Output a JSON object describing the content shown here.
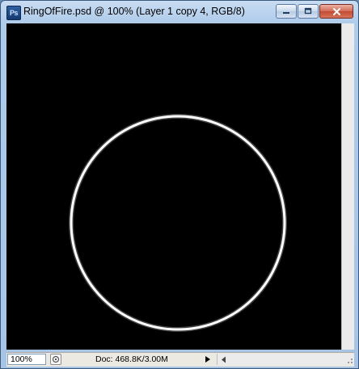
{
  "window": {
    "title": "RingOfFire.psd @ 100% (Layer 1 copy 4, RGB/8)",
    "app_icon_text": "Ps",
    "buttons": {
      "minimize_icon": "minimize-icon",
      "maximize_icon": "maximize-icon",
      "close_icon": "close-icon"
    }
  },
  "canvas": {
    "background": "#000000",
    "ring_color": "#ffffff",
    "content": "ring-of-fire-artwork"
  },
  "statusbar": {
    "zoom": "100%",
    "doc_info": "Doc: 468.8K/3.00M"
  },
  "colors": {
    "title_bar": "#bfd5ee",
    "close_button": "#c8553d",
    "status_bar": "#ece9e2"
  }
}
